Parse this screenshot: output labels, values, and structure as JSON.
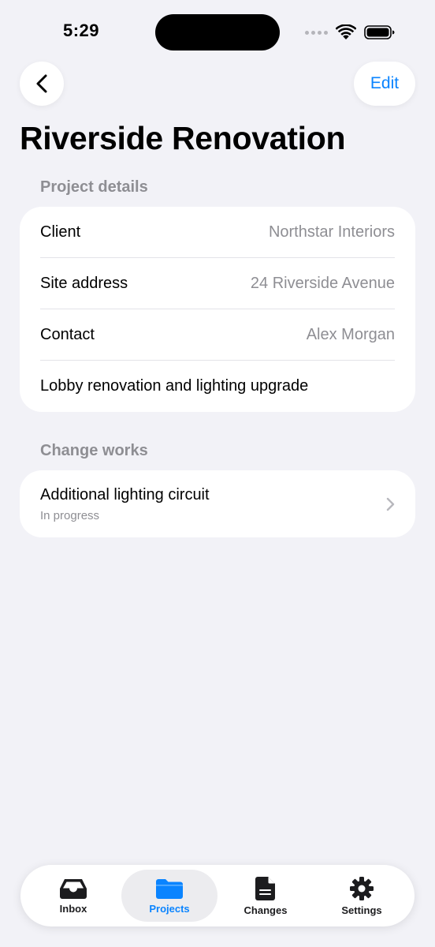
{
  "status_bar": {
    "time": "5:29"
  },
  "nav": {
    "back_icon": "chevron-left-icon",
    "edit_label": "Edit"
  },
  "page": {
    "title": "Riverside Renovation"
  },
  "project_details": {
    "header": "Project details",
    "rows": [
      {
        "label": "Client",
        "value": "Northstar Interiors"
      },
      {
        "label": "Site address",
        "value": "24 Riverside Avenue"
      },
      {
        "label": "Contact",
        "value": "Alex Morgan"
      }
    ],
    "description": "Lobby renovation and lighting upgrade"
  },
  "change_works": {
    "header": "Change works",
    "items": [
      {
        "title": "Additional lighting circuit",
        "status": "In progress"
      }
    ]
  },
  "tab_bar": {
    "tabs": [
      {
        "label": "Inbox",
        "icon": "inbox-tray-icon",
        "active": false
      },
      {
        "label": "Projects",
        "icon": "folder-icon",
        "active": true
      },
      {
        "label": "Changes",
        "icon": "document-icon",
        "active": false
      },
      {
        "label": "Settings",
        "icon": "gear-icon",
        "active": false
      }
    ]
  },
  "colors": {
    "accent": "#0a84ff",
    "background": "#f2f2f7",
    "secondary_text": "#8e8e93"
  }
}
